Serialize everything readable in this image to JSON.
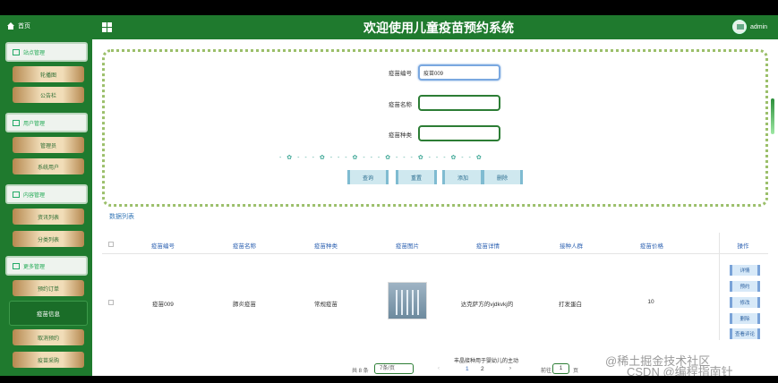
{
  "app": {
    "title": "欢迎使用儿童疫苗预约系统",
    "user": "admin"
  },
  "colors": {
    "brand": "#1f7a2e",
    "accent": "#2a5fb0",
    "menu_item": "#f1ddb8"
  },
  "nav": {
    "home": "首页",
    "groups": [
      {
        "label": "站点管理",
        "items": [
          "轮播图",
          "公告栏"
        ]
      },
      {
        "label": "用户管理",
        "items": [
          "管理员",
          "系统用户"
        ]
      },
      {
        "label": "内容管理",
        "items": [
          "资讯列表",
          "分类列表"
        ]
      },
      {
        "label": "更多管理",
        "items": [
          "预约订单",
          "疫苗信息",
          "取消预约",
          "疫苗采购"
        ]
      }
    ],
    "active": "疫苗信息"
  },
  "search": {
    "fields": [
      {
        "label": "疫苗编号",
        "value": "疫苗009"
      },
      {
        "label": "疫苗名称",
        "value": ""
      },
      {
        "label": "疫苗种类",
        "value": ""
      }
    ],
    "buttons": [
      "查询",
      "重置",
      "添加",
      "删除"
    ]
  },
  "table": {
    "title": "数据列表",
    "columns": [
      "疫苗编号",
      "疫苗名称",
      "疫苗种类",
      "疫苗图片",
      "疫苗详情",
      "接种人群",
      "疫苗价格",
      "操作"
    ],
    "rows": [
      {
        "code": "疫苗009",
        "name": "肺炎疫苗",
        "kind": "常规疫苗",
        "detail": "达克萨方的vjdkvkj的",
        "group": "打发蛋白",
        "price": "10"
      }
    ],
    "row_actions": [
      "详情",
      "预约",
      "修改",
      "删除",
      "查看评论"
    ]
  },
  "pagination": {
    "total": "共 8 条",
    "page_size": "7条/页",
    "pages": [
      "1",
      "2"
    ],
    "goto_label": "前往",
    "goto_value": "1",
    "page_unit": "页",
    "summary": "丰晶接种用于婴幼儿的主动"
  },
  "watermark": {
    "line1": "@稀土掘金技术社区",
    "line2": "CSDN @编程指南针"
  }
}
